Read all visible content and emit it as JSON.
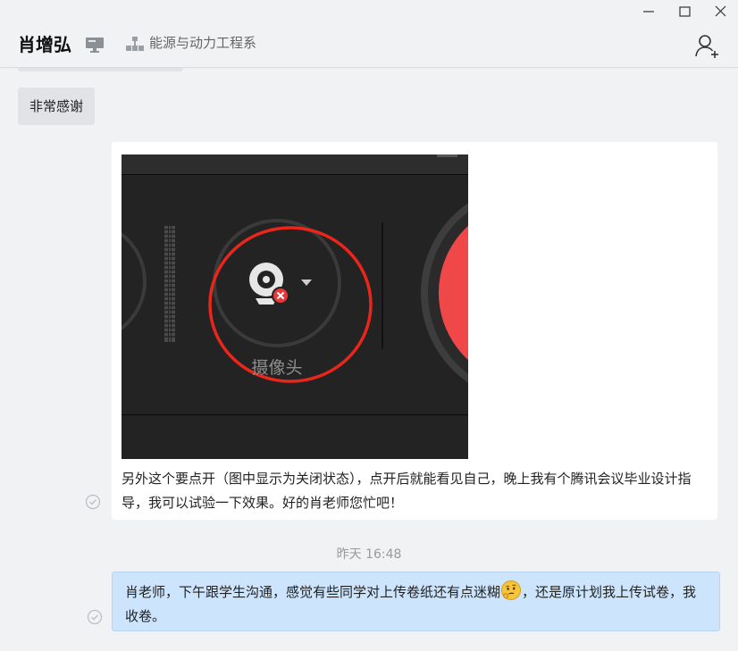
{
  "header": {
    "contact_name": "肖增弘",
    "department": "能源与动力工程系"
  },
  "messages": {
    "received_text": "非常感谢",
    "image_message": {
      "camera_label": "摄像头",
      "text": "另外这个要点开（图中显示为关闭状态），点开后就能看见自己，晚上我有个腾讯会议毕业设计指导，我可以试验一下效果。好的肖老师您忙吧！"
    },
    "timestamp": "昨天 16:48",
    "sent_text_before_emoji": "肖老师，下午跟学生沟通，感觉有些同学对上传卷纸还有点迷糊",
    "sent_text_after_emoji": "，还是原计划我上传试卷，我收卷。"
  },
  "icons": {
    "window_minimize": "minimize-icon",
    "window_maximize": "maximize-icon",
    "window_close": "close-icon",
    "online_status": "pc-monitor-icon",
    "organization": "org-chart-icon",
    "add_contact": "add-contact-icon",
    "read_receipt": "read-check-icon",
    "emoji": "thinking-emoji-icon",
    "camera": "webcam-off-icon"
  },
  "colors": {
    "sent_bubble": "#cce4fc",
    "received_bubble": "#e2e3e6",
    "highlight_circle": "#e8261c",
    "record_button": "#f04848"
  }
}
